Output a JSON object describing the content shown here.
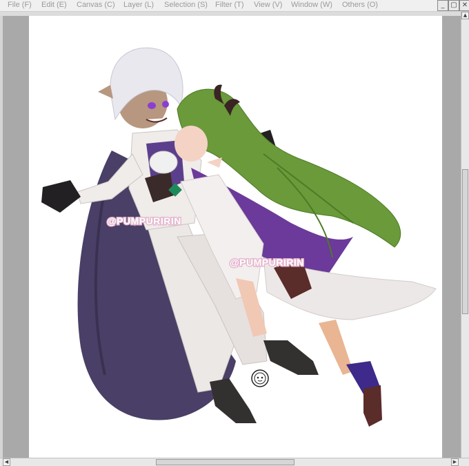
{
  "menubar": {
    "items": [
      {
        "label": "File (F)"
      },
      {
        "label": "Edit (E)"
      },
      {
        "label": "Canvas (C)"
      },
      {
        "label": "Layer (L)"
      },
      {
        "label": "Selection (S)"
      },
      {
        "label": "Filter (T)"
      },
      {
        "label": "View (V)"
      },
      {
        "label": "Window (W)"
      },
      {
        "label": "Others (O)"
      }
    ]
  },
  "window_controls": {
    "minimize": "_",
    "maximize": "▢",
    "close": "✕"
  },
  "canvas": {
    "watermarks": [
      "@PUMPURIRIN",
      "@PUMPURIRIN"
    ]
  },
  "colors": {
    "menu_text": "#9a9a9a",
    "gutter": "#a9a9a9",
    "cape_dark": "#4a3f66",
    "cape_purple": "#6b3a9a",
    "hair_green": "#6a9a3a",
    "hair_white": "#e8e8ee"
  }
}
